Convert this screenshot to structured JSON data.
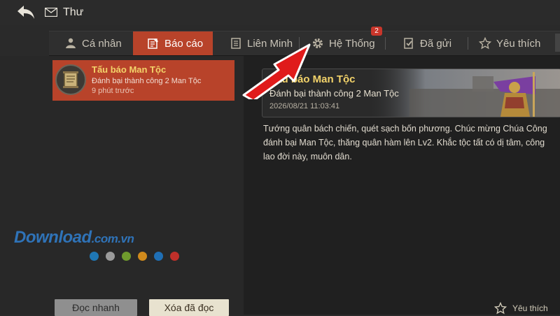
{
  "header": {
    "title": "Thư"
  },
  "tabs": [
    {
      "label": "Cá nhân",
      "icon": "person-icon"
    },
    {
      "label": "Báo cáo",
      "icon": "report-icon",
      "active": true
    },
    {
      "label": "Liên Minh",
      "icon": "alliance-icon"
    },
    {
      "label": "Hệ Thống",
      "icon": "gear-icon",
      "badge": "2"
    },
    {
      "label": "Đã gửi",
      "icon": "sent-icon"
    },
    {
      "label": "Yêu thích",
      "icon": "star-icon"
    }
  ],
  "mail_list": [
    {
      "title": "Tấu báo Man Tộc",
      "subtitle": "Đánh bại thành công 2 Man Tộc",
      "time": "9 phút trước"
    }
  ],
  "detail": {
    "title": "Tấu báo Man Tộc",
    "subtitle": "Đánh bại thành công 2 Man Tộc",
    "datetime": "2026/08/21 11:03:41",
    "body": "Tướng quân bách chiến, quét sạch bốn phương. Chúc mừng Chúa Công đánh bại Man Tộc, thăng quân hàm lên Lv2. Khắc tộc tất có dị tâm, công lao đời này, muôn dân."
  },
  "footer": {
    "quick_read": "Đọc nhanh",
    "delete_read": "Xóa đã đọc",
    "favorite": "Yêu thích"
  },
  "watermark": {
    "main": "Download",
    "domain": ".com.vn"
  },
  "colors": {
    "accent": "#b8432a",
    "title_gold": "#f3d36a",
    "badge": "#c9362b",
    "arrow": "#e01b1b",
    "dots": [
      "#1f77b4",
      "#9a9a9a",
      "#6f9a2d",
      "#d08a1c",
      "#1f6fb5",
      "#c0302a"
    ]
  }
}
